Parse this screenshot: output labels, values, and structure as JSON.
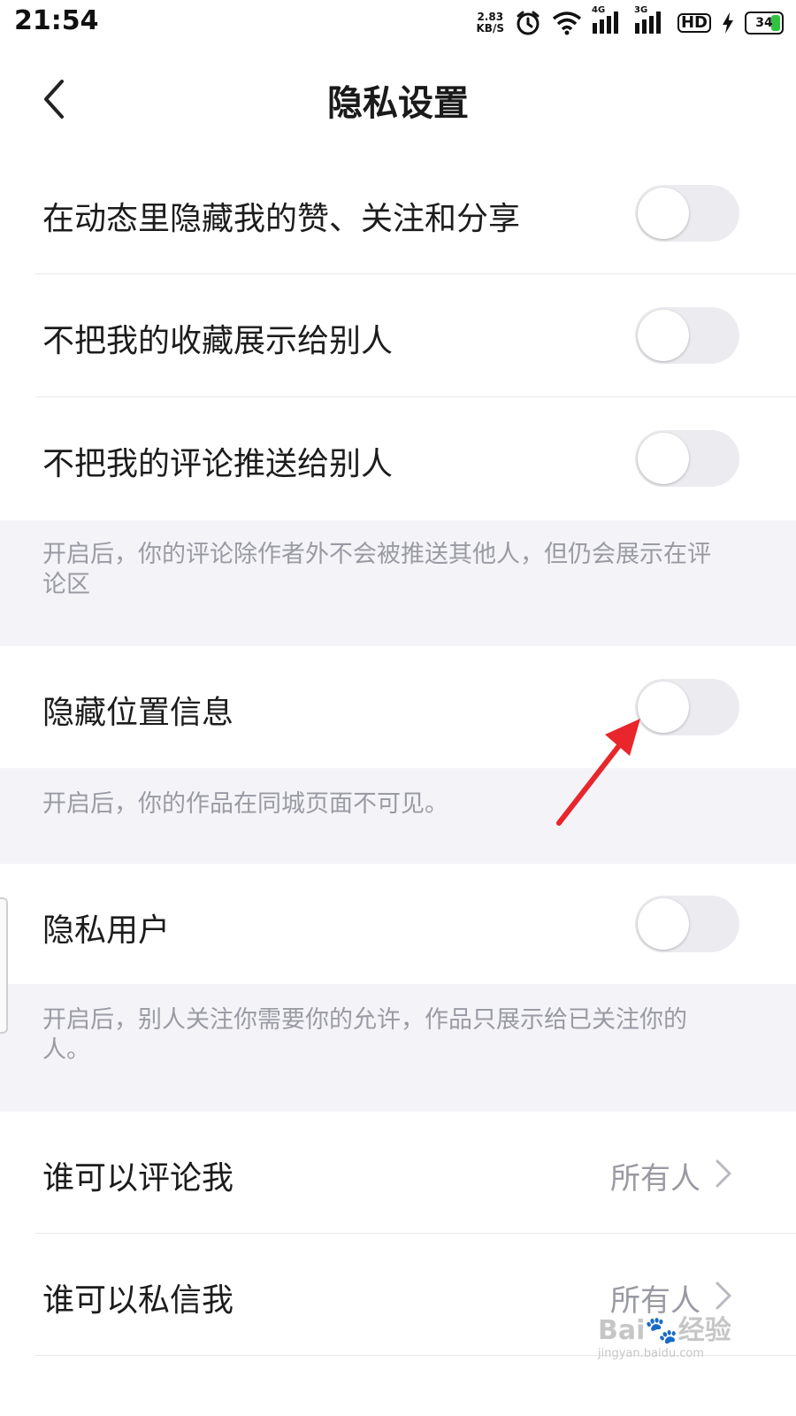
{
  "status_bar": {
    "time": "21:54",
    "net_speed_value": "2.83",
    "net_speed_unit": "KB/S",
    "network_1": "4G",
    "network_2": "3G",
    "hd_label": "HD",
    "battery": "34",
    "icons": [
      "alarm-icon",
      "wifi-icon",
      "signal-icon",
      "signal-icon",
      "charging-icon",
      "battery-icon"
    ]
  },
  "header": {
    "title": "隐私设置",
    "back_icon": "chevron-left-icon"
  },
  "settings": {
    "hide_activity": {
      "label": "在动态里隐藏我的赞、关注和分享",
      "enabled": false
    },
    "hide_favorites": {
      "label": "不把我的收藏展示给别人",
      "enabled": false
    },
    "hide_comments": {
      "label": "不把我的评论推送给别人",
      "enabled": false
    },
    "hide_comments_note": "开启后，你的评论除作者外不会被推送其他人，但仍会展示在评论区",
    "hide_location": {
      "label": "隐藏位置信息",
      "enabled": false
    },
    "hide_location_note": "开启后，你的作品在同城页面不可见。",
    "private_user": {
      "label": "隐私用户",
      "enabled": false
    },
    "private_user_note": "开启后，别人关注你需要你的允许，作品只展示给已关注你的人。",
    "who_can_comment": {
      "label": "谁可以评论我",
      "value": "所有人"
    },
    "who_can_message": {
      "label": "谁可以私信我",
      "value": "所有人"
    }
  },
  "watermark": {
    "main": "Bai🐾经验",
    "sub": "jingyan.baidu.com"
  },
  "colors": {
    "annotation_arrow": "#e8262b",
    "toggle_off": "#ececf0",
    "note_bg": "#f4f4f8"
  }
}
